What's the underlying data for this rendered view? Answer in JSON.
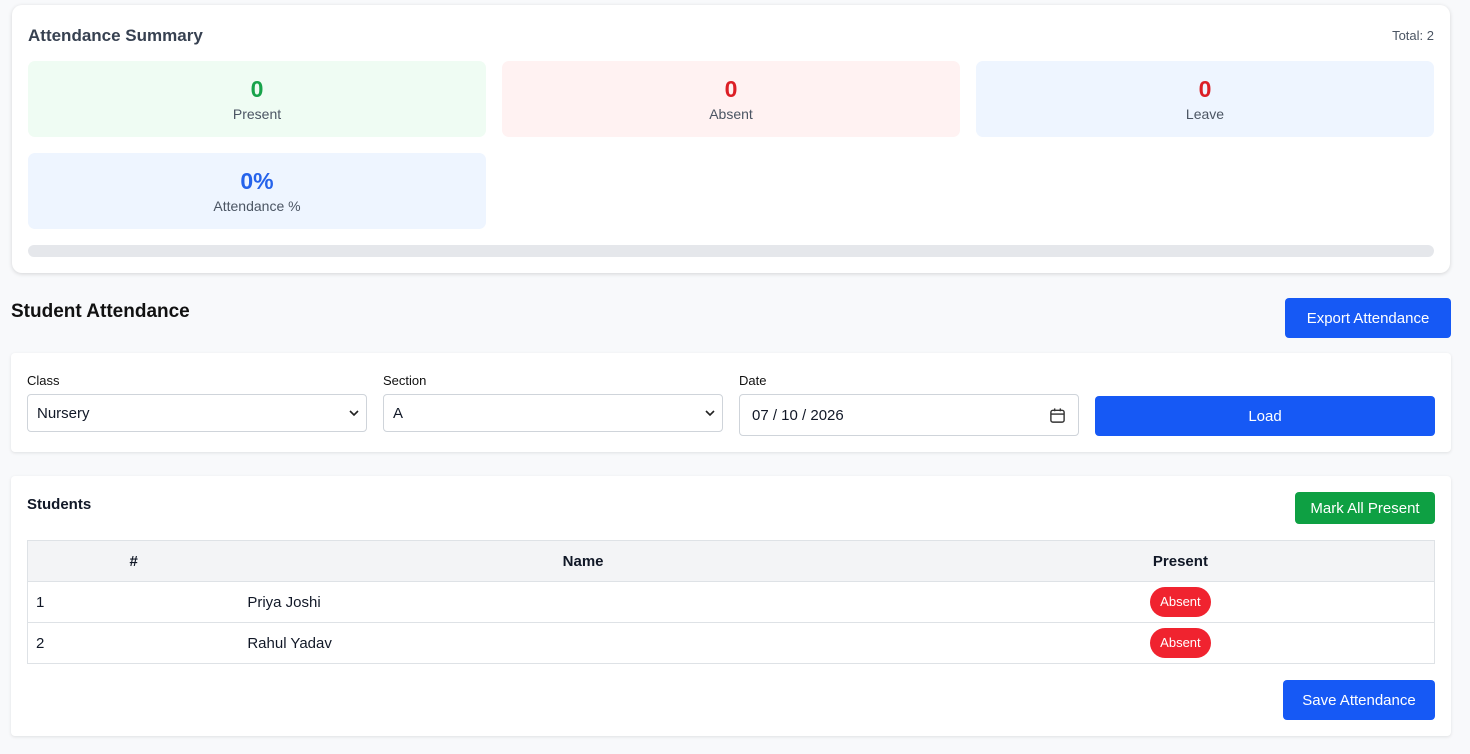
{
  "summary": {
    "title": "Attendance Summary",
    "total_label": "Total: 2",
    "present": {
      "value": "0",
      "label": "Present"
    },
    "absent": {
      "value": "0",
      "label": "Absent"
    },
    "leave": {
      "value": "0",
      "label": "Leave"
    },
    "percentage": {
      "value": "0%",
      "label": "Attendance %"
    },
    "progress_percent": 0
  },
  "page": {
    "heading": "Student Attendance",
    "export_button": "Export Attendance"
  },
  "filters": {
    "class_label": "Class",
    "class_value": "Nursery",
    "section_label": "Section",
    "section_value": "A",
    "date_label": "Date",
    "date_value": "07 / 10 / 2026",
    "load_button": "Load"
  },
  "students": {
    "title": "Students",
    "mark_all_button": "Mark All Present",
    "columns": [
      "#",
      "Name",
      "Present"
    ],
    "rows": [
      {
        "num": "1",
        "name": "Priya Joshi",
        "status": "Absent"
      },
      {
        "num": "2",
        "name": "Rahul Yadav",
        "status": "Absent"
      }
    ],
    "save_button": "Save Attendance"
  },
  "colors": {
    "primary": "#1659f5",
    "success": "#0ea043",
    "danger": "#f0232f",
    "present_text": "#17a34a",
    "absent_text": "#dc1f26",
    "percent_text": "#2563eb"
  }
}
